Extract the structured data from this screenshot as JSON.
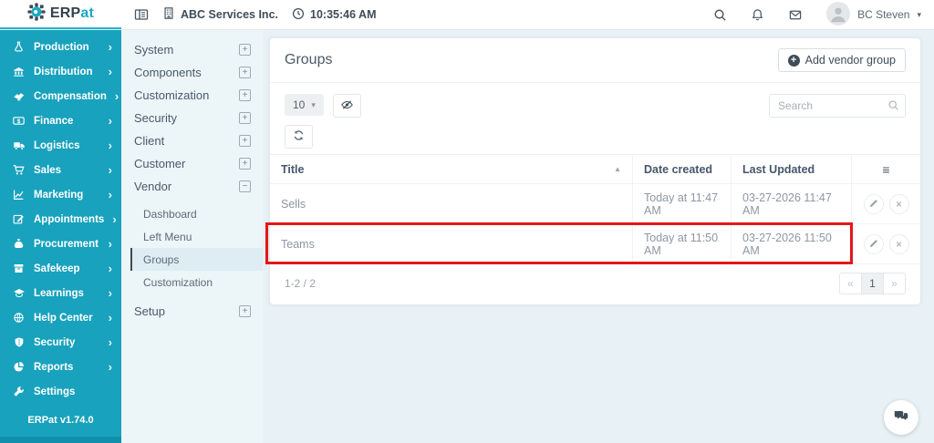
{
  "topbar": {
    "logo_primary": "ERP",
    "logo_secondary": "at",
    "company": "ABC Services Inc.",
    "time": "10:35:46 AM",
    "user": "BC Steven"
  },
  "icons": {
    "chevron": "›",
    "caret_down": "▾",
    "sort_asc": "▲",
    "menu": "≡",
    "plus": "+",
    "minus": "−",
    "close": "×",
    "prev": "«",
    "next": "»"
  },
  "sidebar": {
    "items": [
      {
        "label": "Production",
        "icon": "flask-icon"
      },
      {
        "label": "Distribution",
        "icon": "bank-icon"
      },
      {
        "label": "Compensation",
        "icon": "handshake-icon"
      },
      {
        "label": "Finance",
        "icon": "dollar-icon"
      },
      {
        "label": "Logistics",
        "icon": "truck-icon"
      },
      {
        "label": "Sales",
        "icon": "cart-icon"
      },
      {
        "label": "Marketing",
        "icon": "chart-line-icon"
      },
      {
        "label": "Appointments",
        "icon": "edit-icon"
      },
      {
        "label": "Procurement",
        "icon": "money-bag-icon"
      },
      {
        "label": "Safekeep",
        "icon": "box-icon"
      },
      {
        "label": "Learnings",
        "icon": "graduation-cap-icon"
      },
      {
        "label": "Help Center",
        "icon": "globe-icon"
      },
      {
        "label": "Security",
        "icon": "shield-icon"
      },
      {
        "label": "Reports",
        "icon": "pie-chart-icon"
      },
      {
        "label": "Settings",
        "icon": "wrench-icon"
      }
    ],
    "version": "ERPat v1.74.0"
  },
  "submenu": {
    "items": [
      {
        "label": "System"
      },
      {
        "label": "Components"
      },
      {
        "label": "Customization"
      },
      {
        "label": "Security"
      },
      {
        "label": "Client"
      },
      {
        "label": "Customer"
      },
      {
        "label": "Vendor"
      }
    ],
    "vendor_children": [
      {
        "label": "Dashboard"
      },
      {
        "label": "Left Menu"
      },
      {
        "label": "Groups"
      },
      {
        "label": "Customization"
      }
    ],
    "active_child": "Groups",
    "setup_label": "Setup"
  },
  "main": {
    "title": "Groups",
    "add_button": "Add vendor group",
    "page_size": "10",
    "search_placeholder": "Search",
    "table": {
      "col_title": "Title",
      "col_date": "Date created",
      "col_updated": "Last Updated",
      "rows": [
        {
          "title": "Sells",
          "date_created": "Today at 11:47 AM",
          "last_updated": "03-27-2026 11:47 AM"
        },
        {
          "title": "Teams",
          "date_created": "Today at 11:50 AM",
          "last_updated": "03-27-2026 11:50 AM",
          "highlighted": true
        }
      ]
    },
    "pagination": {
      "range": "1-2 / 2",
      "page": "1"
    }
  },
  "colors": {
    "accent_teal": "#18a2bd",
    "highlight_red": "#e41717"
  }
}
